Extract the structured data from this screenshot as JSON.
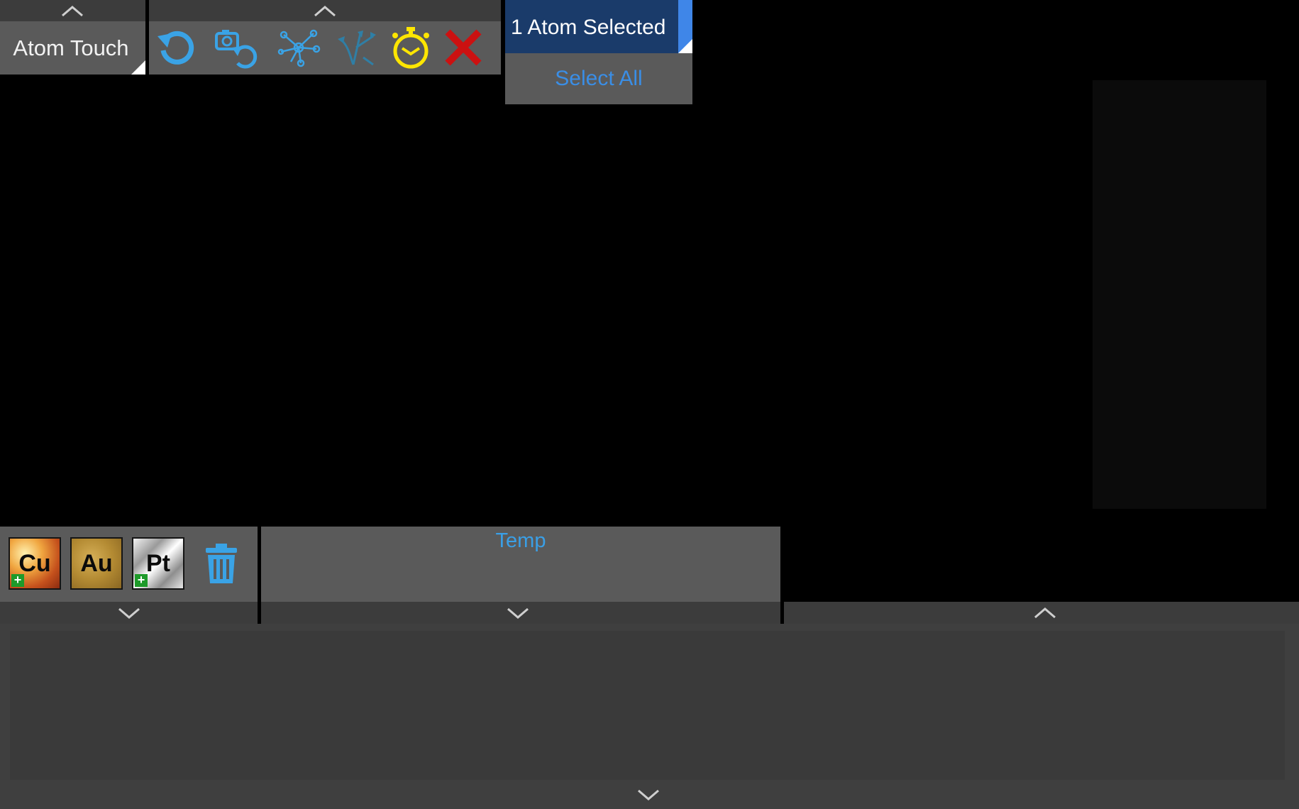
{
  "app": {
    "title": "Atom Touch"
  },
  "toolbar": {
    "tools": [
      {
        "name": "reset-icon",
        "color": "#3aa3e6"
      },
      {
        "name": "camera-reset-icon",
        "color": "#3aa3e6"
      },
      {
        "name": "molecule-network-icon",
        "color": "#3aa3e6"
      },
      {
        "name": "arrows-move-icon",
        "color": "#2f7fa6"
      },
      {
        "name": "stopwatch-icon",
        "color": "#ffe600"
      },
      {
        "name": "close-icon",
        "color": "#cc1111"
      }
    ]
  },
  "selection": {
    "label": "1 Atom Selected",
    "select_all": "Select All",
    "header_color": "#1a3b6a",
    "accent_color": "#3f86e8"
  },
  "palette": {
    "elements": [
      {
        "symbol": "Cu",
        "addable": true
      },
      {
        "symbol": "Au",
        "addable": false
      },
      {
        "symbol": "Pt",
        "addable": true
      }
    ],
    "trash_icon": "trash-icon"
  },
  "temp": {
    "label": "Temp"
  },
  "colors": {
    "accent_blue": "#3a9fe6",
    "panel_gray": "#5a5a5a",
    "strip_gray": "#3c3c3c"
  }
}
